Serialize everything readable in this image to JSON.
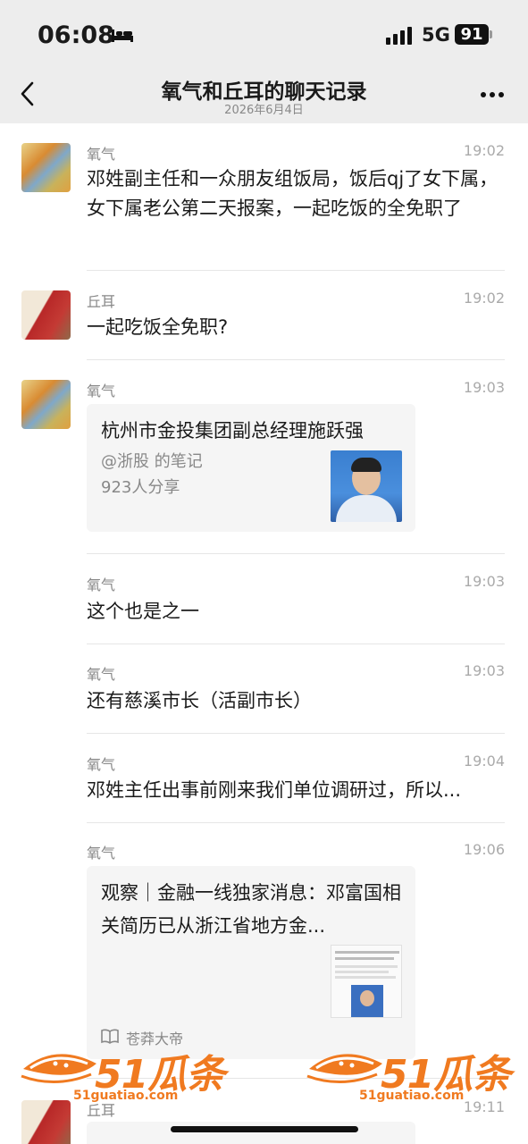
{
  "status_bar": {
    "time": "06:08",
    "network": "5G",
    "battery": "91"
  },
  "header": {
    "title": "氧气和丘耳的聊天记录",
    "subtitle": "2026年6月4日"
  },
  "messages": [
    {
      "sender": "氧气",
      "time": "19:02",
      "text": "邓姓副主任和一众朋友组饭局，饭后qj了女下属，女下属老公第二天报案，一起吃饭的全免职了"
    },
    {
      "sender": "丘耳",
      "time": "19:02",
      "text": "一起吃饭全免职?"
    },
    {
      "sender": "氧气",
      "time": "19:03",
      "card": {
        "title": "杭州市金投集团副总经理施跃强",
        "source": "@浙股 的笔记",
        "shares": "923人分享"
      }
    },
    {
      "sender": "氧气",
      "time": "19:03",
      "text": "这个也是之一"
    },
    {
      "sender": "氧气",
      "time": "19:03",
      "text": "还有慈溪市长（活副市长）"
    },
    {
      "sender": "氧气",
      "time": "19:04",
      "text": "邓姓主任出事前刚来我们单位调研过，所以..."
    },
    {
      "sender": "氧气",
      "time": "19:06",
      "card": {
        "title": "观察｜金融一线独家消息：邓富国相关简历已从浙江省地方金...",
        "source": "苍莽大帝"
      }
    },
    {
      "sender": "丘耳",
      "time": "19:11"
    }
  ],
  "watermark": {
    "brand": "51瓜条",
    "url": "51guatiao.com"
  },
  "icons": {
    "back": "back-chevron-icon",
    "more": "more-dots-icon",
    "source": "book-icon"
  }
}
